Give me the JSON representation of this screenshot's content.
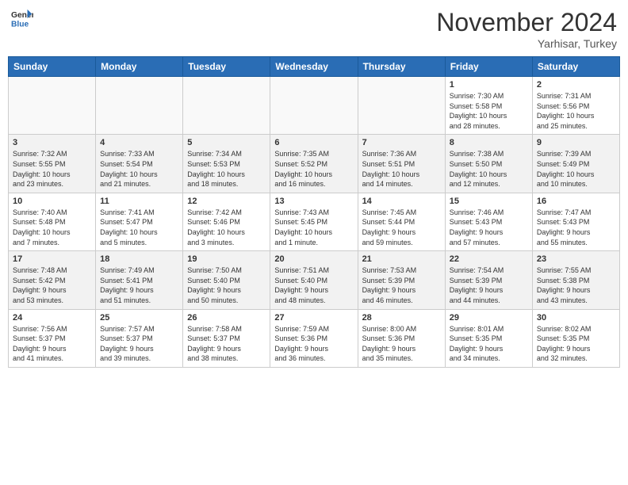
{
  "header": {
    "logo_line1": "General",
    "logo_line2": "Blue",
    "month": "November 2024",
    "location": "Yarhisar, Turkey"
  },
  "weekdays": [
    "Sunday",
    "Monday",
    "Tuesday",
    "Wednesday",
    "Thursday",
    "Friday",
    "Saturday"
  ],
  "weeks": [
    [
      {
        "day": "",
        "info": ""
      },
      {
        "day": "",
        "info": ""
      },
      {
        "day": "",
        "info": ""
      },
      {
        "day": "",
        "info": ""
      },
      {
        "day": "",
        "info": ""
      },
      {
        "day": "1",
        "info": "Sunrise: 7:30 AM\nSunset: 5:58 PM\nDaylight: 10 hours\nand 28 minutes."
      },
      {
        "day": "2",
        "info": "Sunrise: 7:31 AM\nSunset: 5:56 PM\nDaylight: 10 hours\nand 25 minutes."
      }
    ],
    [
      {
        "day": "3",
        "info": "Sunrise: 7:32 AM\nSunset: 5:55 PM\nDaylight: 10 hours\nand 23 minutes."
      },
      {
        "day": "4",
        "info": "Sunrise: 7:33 AM\nSunset: 5:54 PM\nDaylight: 10 hours\nand 21 minutes."
      },
      {
        "day": "5",
        "info": "Sunrise: 7:34 AM\nSunset: 5:53 PM\nDaylight: 10 hours\nand 18 minutes."
      },
      {
        "day": "6",
        "info": "Sunrise: 7:35 AM\nSunset: 5:52 PM\nDaylight: 10 hours\nand 16 minutes."
      },
      {
        "day": "7",
        "info": "Sunrise: 7:36 AM\nSunset: 5:51 PM\nDaylight: 10 hours\nand 14 minutes."
      },
      {
        "day": "8",
        "info": "Sunrise: 7:38 AM\nSunset: 5:50 PM\nDaylight: 10 hours\nand 12 minutes."
      },
      {
        "day": "9",
        "info": "Sunrise: 7:39 AM\nSunset: 5:49 PM\nDaylight: 10 hours\nand 10 minutes."
      }
    ],
    [
      {
        "day": "10",
        "info": "Sunrise: 7:40 AM\nSunset: 5:48 PM\nDaylight: 10 hours\nand 7 minutes."
      },
      {
        "day": "11",
        "info": "Sunrise: 7:41 AM\nSunset: 5:47 PM\nDaylight: 10 hours\nand 5 minutes."
      },
      {
        "day": "12",
        "info": "Sunrise: 7:42 AM\nSunset: 5:46 PM\nDaylight: 10 hours\nand 3 minutes."
      },
      {
        "day": "13",
        "info": "Sunrise: 7:43 AM\nSunset: 5:45 PM\nDaylight: 10 hours\nand 1 minute."
      },
      {
        "day": "14",
        "info": "Sunrise: 7:45 AM\nSunset: 5:44 PM\nDaylight: 9 hours\nand 59 minutes."
      },
      {
        "day": "15",
        "info": "Sunrise: 7:46 AM\nSunset: 5:43 PM\nDaylight: 9 hours\nand 57 minutes."
      },
      {
        "day": "16",
        "info": "Sunrise: 7:47 AM\nSunset: 5:43 PM\nDaylight: 9 hours\nand 55 minutes."
      }
    ],
    [
      {
        "day": "17",
        "info": "Sunrise: 7:48 AM\nSunset: 5:42 PM\nDaylight: 9 hours\nand 53 minutes."
      },
      {
        "day": "18",
        "info": "Sunrise: 7:49 AM\nSunset: 5:41 PM\nDaylight: 9 hours\nand 51 minutes."
      },
      {
        "day": "19",
        "info": "Sunrise: 7:50 AM\nSunset: 5:40 PM\nDaylight: 9 hours\nand 50 minutes."
      },
      {
        "day": "20",
        "info": "Sunrise: 7:51 AM\nSunset: 5:40 PM\nDaylight: 9 hours\nand 48 minutes."
      },
      {
        "day": "21",
        "info": "Sunrise: 7:53 AM\nSunset: 5:39 PM\nDaylight: 9 hours\nand 46 minutes."
      },
      {
        "day": "22",
        "info": "Sunrise: 7:54 AM\nSunset: 5:39 PM\nDaylight: 9 hours\nand 44 minutes."
      },
      {
        "day": "23",
        "info": "Sunrise: 7:55 AM\nSunset: 5:38 PM\nDaylight: 9 hours\nand 43 minutes."
      }
    ],
    [
      {
        "day": "24",
        "info": "Sunrise: 7:56 AM\nSunset: 5:37 PM\nDaylight: 9 hours\nand 41 minutes."
      },
      {
        "day": "25",
        "info": "Sunrise: 7:57 AM\nSunset: 5:37 PM\nDaylight: 9 hours\nand 39 minutes."
      },
      {
        "day": "26",
        "info": "Sunrise: 7:58 AM\nSunset: 5:37 PM\nDaylight: 9 hours\nand 38 minutes."
      },
      {
        "day": "27",
        "info": "Sunrise: 7:59 AM\nSunset: 5:36 PM\nDaylight: 9 hours\nand 36 minutes."
      },
      {
        "day": "28",
        "info": "Sunrise: 8:00 AM\nSunset: 5:36 PM\nDaylight: 9 hours\nand 35 minutes."
      },
      {
        "day": "29",
        "info": "Sunrise: 8:01 AM\nSunset: 5:35 PM\nDaylight: 9 hours\nand 34 minutes."
      },
      {
        "day": "30",
        "info": "Sunrise: 8:02 AM\nSunset: 5:35 PM\nDaylight: 9 hours\nand 32 minutes."
      }
    ]
  ]
}
